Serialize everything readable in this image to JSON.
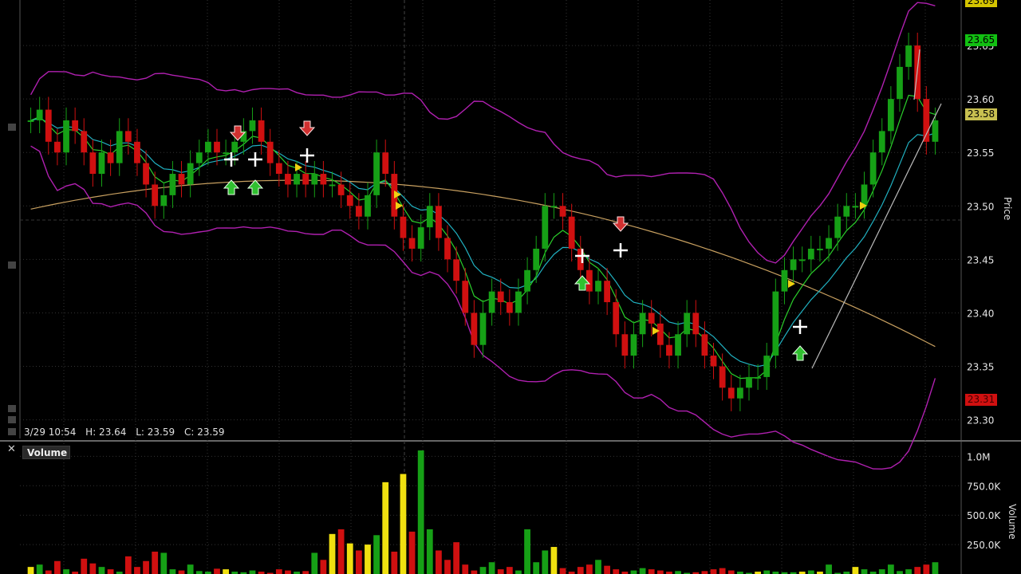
{
  "ohlc": {
    "date": "3/29 10:54",
    "high": "H: 23.64",
    "low": "L: 23.59",
    "close": "C: 23.59"
  },
  "price_panel": {
    "axis_title": "Price",
    "tags": {
      "top": "23.69",
      "last": "23.65",
      "mid": "23.58",
      "low": "23.31"
    }
  },
  "volume_panel": {
    "title": "Volume",
    "axis_title": "Volume"
  },
  "colors": {
    "up": "#16a016",
    "down": "#d01010",
    "neutral_volume": "#f0e010",
    "bollinger": "#b020b0",
    "ema_fast": "#2bd02b",
    "ema_mid": "#20b0c0",
    "sma_long": "#c8a060",
    "grid": "#333333"
  },
  "chart_data": [
    {
      "type": "candlestick",
      "title": "",
      "ylabel": "Price",
      "y_ticks": [
        "23.30",
        "23.35",
        "23.40",
        "23.45",
        "23.50",
        "23.55",
        "23.60",
        "23.65"
      ],
      "ylim": [
        23.29,
        23.7
      ],
      "close": [
        23.58,
        23.59,
        23.56,
        23.55,
        23.58,
        23.57,
        23.55,
        23.53,
        23.55,
        23.54,
        23.57,
        23.56,
        23.54,
        23.52,
        23.5,
        23.51,
        23.53,
        23.52,
        23.54,
        23.55,
        23.56,
        23.55,
        23.55,
        23.56,
        23.57,
        23.58,
        23.56,
        23.54,
        23.53,
        23.52,
        23.53,
        23.52,
        23.53,
        23.52,
        23.52,
        23.51,
        23.5,
        23.49,
        23.51,
        23.55,
        23.53,
        23.49,
        23.47,
        23.46,
        23.48,
        23.5,
        23.47,
        23.45,
        23.43,
        23.4,
        23.37,
        23.4,
        23.42,
        23.41,
        23.4,
        23.42,
        23.44,
        23.46,
        23.5,
        23.5,
        23.49,
        23.46,
        23.44,
        23.42,
        23.43,
        23.41,
        23.38,
        23.36,
        23.38,
        23.4,
        23.39,
        23.37,
        23.36,
        23.38,
        23.4,
        23.38,
        23.36,
        23.35,
        23.33,
        23.32,
        23.33,
        23.34,
        23.34,
        23.36,
        23.42,
        23.44,
        23.45,
        23.45,
        23.46,
        23.46,
        23.47,
        23.49,
        23.5,
        23.5,
        23.52,
        23.55,
        23.57,
        23.6,
        23.63,
        23.65,
        23.6,
        23.56,
        23.58
      ],
      "open_offset_note": "",
      "overlays": [
        "Bollinger Bands",
        "EMA fast",
        "EMA slow",
        "SMA long"
      ]
    },
    {
      "type": "bar",
      "title": "Volume",
      "y_ticks": [
        "1.0M",
        "750.0K",
        "500.0K",
        "250.0K"
      ],
      "ylim": [
        0,
        1050000
      ],
      "values": [
        60000,
        80000,
        30000,
        110000,
        40000,
        20000,
        130000,
        90000,
        60000,
        40000,
        20000,
        150000,
        60000,
        110000,
        190000,
        180000,
        40000,
        30000,
        80000,
        25000,
        20000,
        45000,
        40000,
        20000,
        15000,
        30000,
        20000,
        10000,
        40000,
        30000,
        20000,
        25000,
        180000,
        120000,
        340000,
        380000,
        260000,
        200000,
        250000,
        330000,
        780000,
        190000,
        850000,
        360000,
        1050000,
        380000,
        200000,
        120000,
        270000,
        80000,
        30000,
        60000,
        100000,
        40000,
        60000,
        30000,
        380000,
        100000,
        200000,
        230000,
        50000,
        20000,
        60000,
        80000,
        120000,
        70000,
        40000,
        20000,
        30000,
        50000,
        40000,
        30000,
        20000,
        25000,
        10000,
        15000,
        25000,
        40000,
        50000,
        30000,
        20000,
        10000,
        20000,
        30000,
        20000,
        15000,
        15000,
        20000,
        30000,
        20000,
        80000,
        10000,
        20000,
        60000,
        40000,
        20000,
        40000,
        80000,
        25000,
        40000,
        60000,
        80000,
        100000
      ]
    }
  ]
}
